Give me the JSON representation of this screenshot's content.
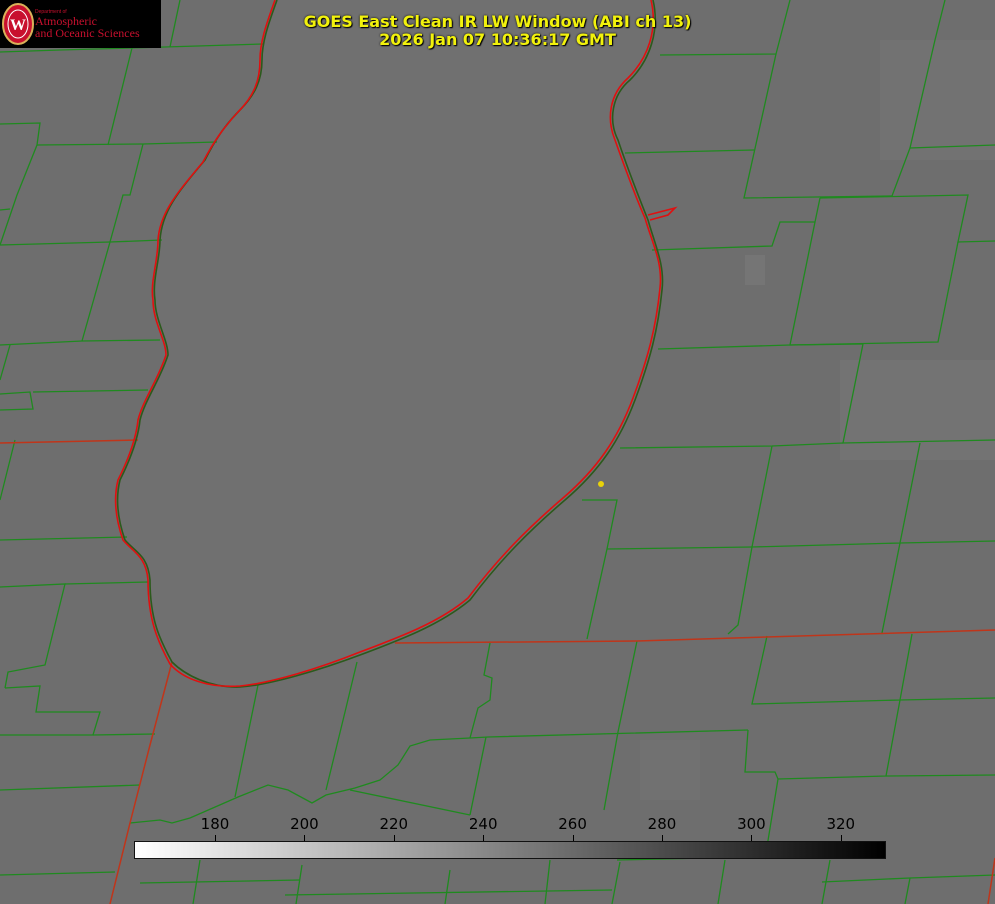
{
  "header": {
    "title_line1": "GOES East Clean IR LW Window (ABI ch 13)",
    "title_line2": "2026 Jan 07 10:36:17 GMT"
  },
  "logo": {
    "department_label": "Department of",
    "line1": "Atmospheric",
    "line2": "and Oceanic Sciences",
    "shield_letter": "W",
    "color": "#c8102e"
  },
  "colorbar": {
    "ticks": [
      "180",
      "200",
      "220",
      "240",
      "260",
      "280",
      "300",
      "320"
    ],
    "gradient_from": "#ffffff",
    "gradient_to": "#000000"
  },
  "map": {
    "background_color": "#6e6e6e",
    "lake_color": "#707070",
    "county_line_color": "#1f8a1f",
    "state_line_color": "#c0351a",
    "shoreline_color": "#e01010",
    "marker_color": "#e8d20a"
  }
}
